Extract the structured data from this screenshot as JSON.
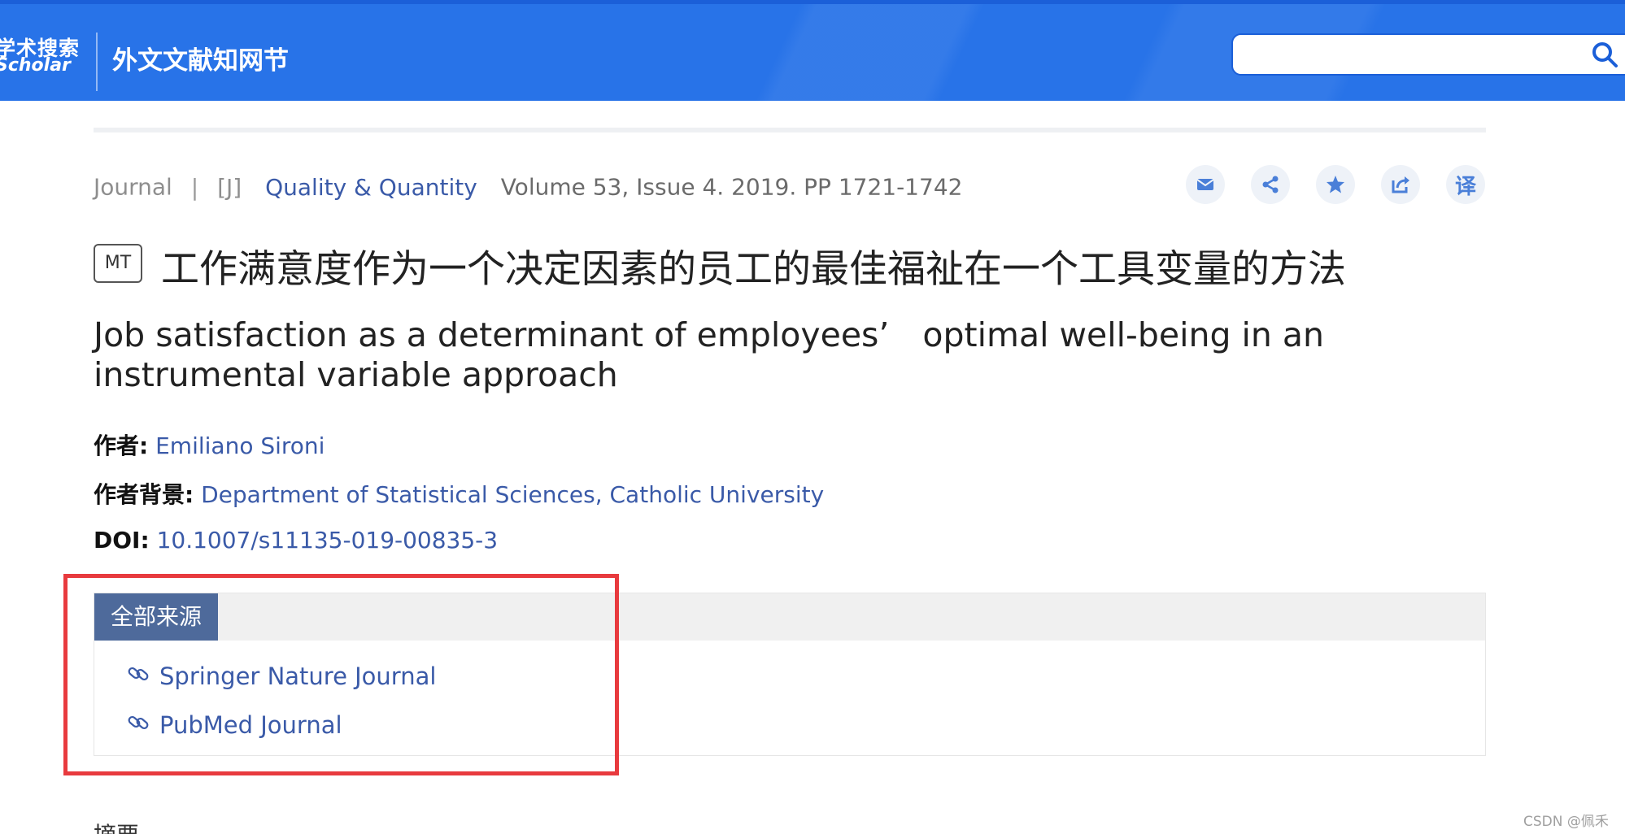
{
  "header": {
    "logo_cn": "学术搜索",
    "logo_en": "Scholar",
    "site_name": "外文文献知网节",
    "search": {
      "value": "",
      "placeholder": ""
    }
  },
  "article": {
    "type": "Journal",
    "separator": "|",
    "journal_tag": "[J]",
    "journal_name": "Quality & Quantity",
    "volume_info": "Volume 53, Issue 4. 2019. PP 1721-1742",
    "badge": "MT",
    "cn_title": "工作满意度作为一个决定因素的员工的最佳福祉在一个工具变量的方法",
    "en_title": "Job satisfaction as a determinant of employees’　optimal well-being in an instrumental variable approach"
  },
  "actions": [
    {
      "name": "email",
      "icon": "envelope-icon",
      "label": ""
    },
    {
      "name": "share",
      "icon": "share-icon",
      "label": ""
    },
    {
      "name": "favorite",
      "icon": "star-icon",
      "label": ""
    },
    {
      "name": "export",
      "icon": "export-icon",
      "label": ""
    },
    {
      "name": "translate",
      "icon": "translate-icon",
      "label": "译"
    }
  ],
  "info": {
    "author_label": "作者:",
    "author_value": "Emiliano Sironi",
    "affiliation_label": "作者背景:",
    "affiliation_value": "Department of Statistical Sciences, Catholic University",
    "doi_label": "DOI:",
    "doi_value": "10.1007/s11135-019-00835-3"
  },
  "sources": {
    "tab_label": "全部来源",
    "items": [
      {
        "label": "Springer Nature Journal"
      },
      {
        "label": "PubMed Journal"
      }
    ]
  },
  "partial_text": "摘要",
  "watermark": "CSDN @佩禾",
  "colors": {
    "header_bg": "#2873e8",
    "link": "#3a5aa8",
    "tab_bg": "#4e6a9b",
    "highlight_box": "#e83a3e"
  }
}
